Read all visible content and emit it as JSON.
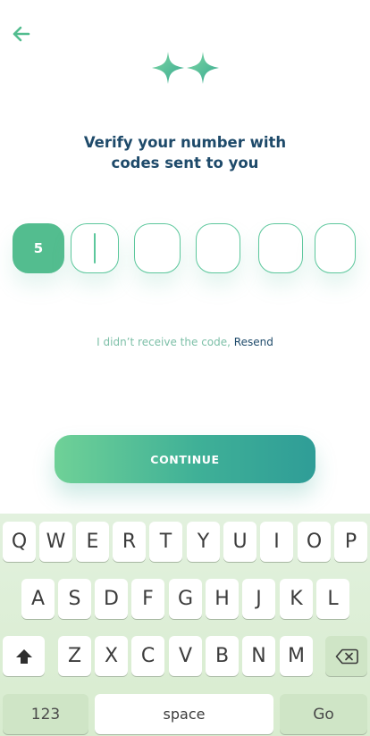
{
  "header": {
    "back_icon": "arrow-left-icon",
    "logo_icon": "sparkle-stars-icon"
  },
  "title_line1": "Verify your number with",
  "title_line2": "codes sent to you",
  "otp": {
    "digits": [
      "5",
      "",
      "",
      "",
      "",
      ""
    ],
    "active_index": 1
  },
  "resend": {
    "prompt": "I didn’t receive the code,",
    "link": "Resend"
  },
  "continue_label": "CONTINUE",
  "keyboard": {
    "row1": [
      "Q",
      "W",
      "E",
      "R",
      "T",
      "Y",
      "U",
      "I",
      "O",
      "P"
    ],
    "row2": [
      "A",
      "S",
      "D",
      "F",
      "G",
      "H",
      "J",
      "K",
      "L"
    ],
    "row3": [
      "Z",
      "X",
      "C",
      "V",
      "B",
      "N",
      "M"
    ],
    "shift_icon": "shift-arrow-icon",
    "backspace_icon": "backspace-icon",
    "numbers_label": "123",
    "space_label": "space",
    "go_label": "Go"
  },
  "colors": {
    "accent": "#53bd8f",
    "title": "#1e4a6a",
    "keyboard_bg": "#d8eccf"
  }
}
